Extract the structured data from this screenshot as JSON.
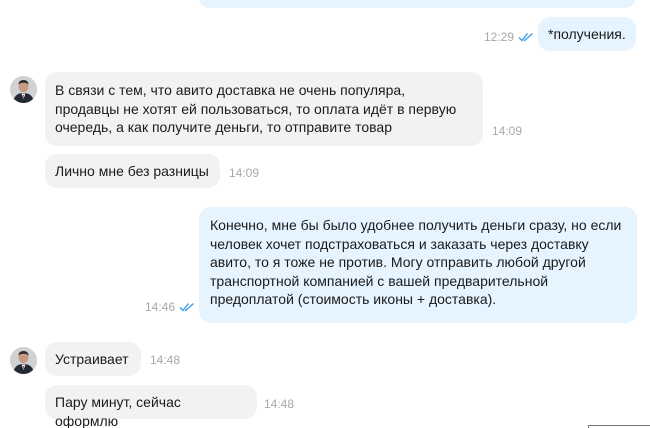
{
  "colors": {
    "incoming_bubble": "#f2f2f2",
    "outgoing_bubble": "#e5f4ff",
    "timestamp": "#a8a8a8",
    "read_checks": "#3d9be9"
  },
  "messages": [
    {
      "direction": "out",
      "text": "*получения.",
      "time": "12:29",
      "status_icon": "double-check-icon"
    },
    {
      "direction": "in",
      "text": "В связи с тем, что авито доставка не очень популяра, продавцы не хотят ей пользоваться, то оплата идёт в первую очередь, а как получите деньги, то отправите товар",
      "time": "14:09",
      "avatar_icon": "avatar"
    },
    {
      "direction": "in",
      "text": "Лично мне без разницы",
      "time": "14:09"
    },
    {
      "direction": "out",
      "text": "Конечно, мне бы было удобнее получить деньги сразу, но если человек хочет подстраховаться и заказать через доставку авито, то я тоже не против. Могу отправить любой другой транспортной компанией с вашей предварительной предоплатой (стоимость иконы + доставка).",
      "time": "14:46",
      "status_icon": "double-check-icon"
    },
    {
      "direction": "in",
      "text": "Устраивает",
      "time": "14:48",
      "avatar_icon": "avatar"
    },
    {
      "direction": "in",
      "text": "Пару минут, сейчас оформлю",
      "time": "14:48"
    }
  ]
}
